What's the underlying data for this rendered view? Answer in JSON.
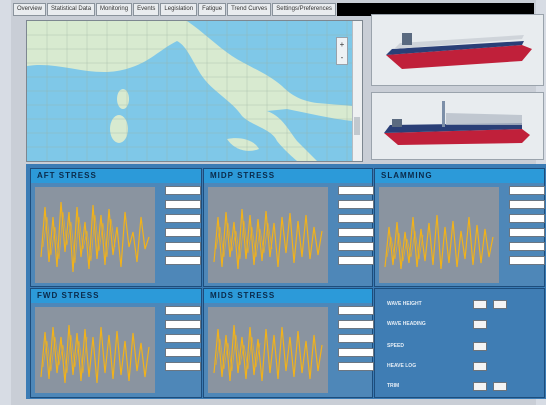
{
  "tabs": [
    "Overview",
    "Statistical Data",
    "Monitoring",
    "Events",
    "Legislation",
    "Fatigue",
    "Trend Curves",
    "Settings/Preferences"
  ],
  "map": {
    "zoom_in": "+",
    "zoom_out": "-"
  },
  "panels": [
    {
      "title": "AFT STRESS"
    },
    {
      "title": "MIDP STRESS"
    },
    {
      "title": "SLAMMING"
    },
    {
      "title": "FWD STRESS"
    },
    {
      "title": "MIDS STRESS"
    }
  ],
  "settings": {
    "rows": [
      {
        "label": "WAVE HEIGHT"
      },
      {
        "label": "WAVE HEADING"
      },
      {
        "label": "SPEED"
      },
      {
        "label": "HEAVE LOG"
      },
      {
        "label": "TRIM"
      }
    ]
  },
  "colors": {
    "trace": "#f2b21a",
    "panel_header": "#2c9ad9",
    "panel_bg": "#3b7cb5",
    "ship_hull": "#c0203a"
  }
}
